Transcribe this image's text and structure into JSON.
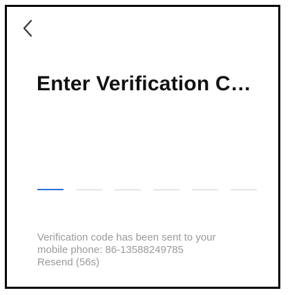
{
  "header": {
    "back_icon": "chevron-left-icon"
  },
  "title": "Enter Verification C…",
  "code_input": {
    "slots": 6,
    "active_slot": 0,
    "active_color": "#2a6fdb",
    "inactive_color": "#cfcfcf"
  },
  "info": {
    "sent_text": "Verification code has been sent to your",
    "phone_text": "mobile phone: 86-13588249785",
    "resend_label": "Resend (56s)"
  }
}
